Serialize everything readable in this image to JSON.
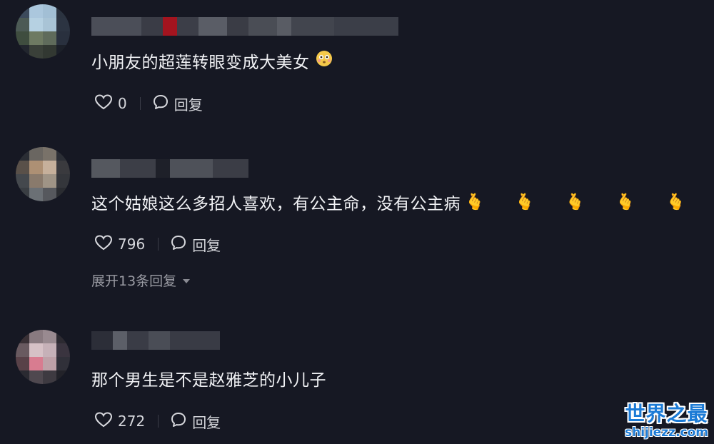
{
  "comments": [
    {
      "text": "小朋友的超莲转眼变成大美女",
      "emoji": "😳",
      "likes": "0",
      "reply_label": "回复"
    },
    {
      "text": "这个姑娘这么多招人喜欢，有公主命，没有公主病",
      "emoji": "🫰 🫰 🫰 🫰 🫰 🫰",
      "likes": "796",
      "reply_label": "回复",
      "expand_label": "展开13条回复"
    },
    {
      "text": "那个男生是不是赵雅芝的小儿子",
      "likes": "272",
      "reply_label": "回复"
    }
  ],
  "watermark": {
    "title": "世界之最",
    "url": "shijiezz.com"
  },
  "colors": {
    "background": "#161823",
    "text": "#f1f2f5",
    "muted": "#9a9ba3",
    "watermark": "#1c7bd6"
  },
  "icons": [
    "heart-icon",
    "comment-bubble-icon",
    "caret-down-icon"
  ]
}
